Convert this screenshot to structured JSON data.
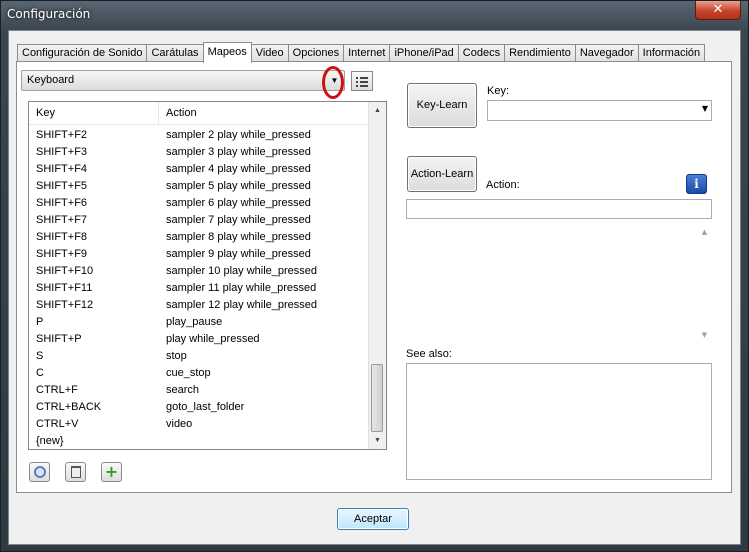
{
  "window": {
    "title": "Configuración",
    "close_glyph": "✕"
  },
  "tabs": [
    {
      "label": "Configuración de Sonido"
    },
    {
      "label": "Carátulas"
    },
    {
      "label": "Mapeos"
    },
    {
      "label": "Video"
    },
    {
      "label": "Opciones"
    },
    {
      "label": "Internet"
    },
    {
      "label": "iPhone/iPad"
    },
    {
      "label": "Codecs"
    },
    {
      "label": "Rendimiento"
    },
    {
      "label": "Navegador"
    },
    {
      "label": "Información"
    }
  ],
  "active_tab": "Mapeos",
  "mapping_select": {
    "value": "Keyboard"
  },
  "list": {
    "col_key": "Key",
    "col_action": "Action",
    "rows": [
      {
        "key": "SHIFT+F2",
        "action": "sampler 2 play while_pressed"
      },
      {
        "key": "SHIFT+F3",
        "action": "sampler 3 play while_pressed"
      },
      {
        "key": "SHIFT+F4",
        "action": "sampler 4 play while_pressed"
      },
      {
        "key": "SHIFT+F5",
        "action": "sampler 5 play while_pressed"
      },
      {
        "key": "SHIFT+F6",
        "action": "sampler 6 play while_pressed"
      },
      {
        "key": "SHIFT+F7",
        "action": "sampler 7 play while_pressed"
      },
      {
        "key": "SHIFT+F8",
        "action": "sampler 8 play while_pressed"
      },
      {
        "key": "SHIFT+F9",
        "action": "sampler 9 play while_pressed"
      },
      {
        "key": "SHIFT+F10",
        "action": "sampler 10 play while_pressed"
      },
      {
        "key": "SHIFT+F11",
        "action": "sampler 11 play while_pressed"
      },
      {
        "key": "SHIFT+F12",
        "action": "sampler 12 play while_pressed"
      },
      {
        "key": "P",
        "action": "play_pause"
      },
      {
        "key": "SHIFT+P",
        "action": "play while_pressed"
      },
      {
        "key": "S",
        "action": "stop"
      },
      {
        "key": "C",
        "action": "cue_stop"
      },
      {
        "key": "CTRL+F",
        "action": "search"
      },
      {
        "key": "CTRL+BACK",
        "action": "goto_last_folder"
      },
      {
        "key": "CTRL+V",
        "action": "video"
      },
      {
        "key": "{new}",
        "action": ""
      }
    ]
  },
  "right": {
    "key_learn": "Key-Learn",
    "key_label": "Key:",
    "key_value": "",
    "action_learn": "Action-Learn",
    "action_label": "Action:",
    "action_value": "",
    "see_also_label": "See also:"
  },
  "footer": {
    "accept": "Aceptar"
  },
  "icons": {
    "dropdown": "▼",
    "scroll_up": "▲",
    "scroll_down": "▼",
    "info": "i",
    "add": "+",
    "trash": "🗑"
  },
  "colors": {
    "highlight_circle": "#d01010",
    "add_green": "#2e9e2e",
    "info_blue": "#1a4aa8"
  }
}
